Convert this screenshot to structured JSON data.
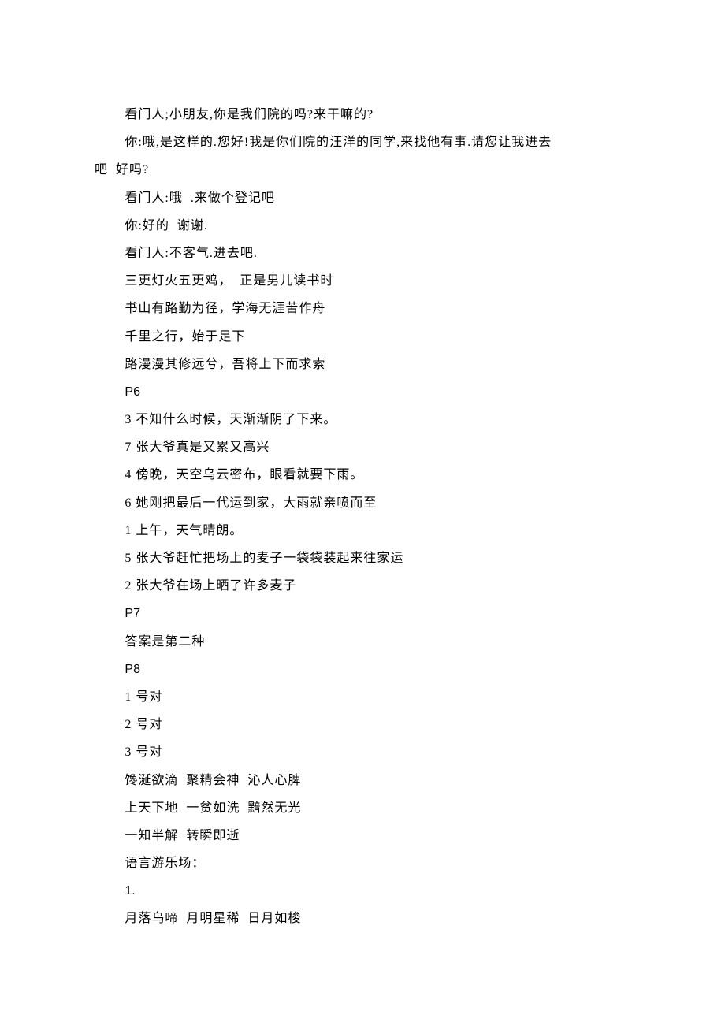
{
  "lines": [
    {
      "text": "看门人;小朋友,你是我们院的吗?来干嘛的?",
      "indent": true
    },
    {
      "text": "你:哦,是这样的.您好!我是你们院的汪洋的同学,来找他有事.请您让我进去",
      "indent": true
    },
    {
      "text": "吧  好吗?",
      "indent": false
    },
    {
      "text": "看门人:哦  .来做个登记吧",
      "indent": true
    },
    {
      "text": "你:好的  谢谢.",
      "indent": true
    },
    {
      "text": "看门人:不客气.进去吧.",
      "indent": true
    },
    {
      "text": "三更灯火五更鸡，  正是男儿读书时",
      "indent": true
    },
    {
      "text": "书山有路勤为径，学海无涯苦作舟",
      "indent": true
    },
    {
      "text": "千里之行，始于足下",
      "indent": true
    },
    {
      "text": "路漫漫其修远兮，吾将上下而求索",
      "indent": true
    },
    {
      "text": "P6",
      "indent": true,
      "alpha": true
    },
    {
      "text": "3 不知什么时候，天渐渐阴了下来。",
      "indent": true
    },
    {
      "text": "7 张大爷真是又累又高兴",
      "indent": true
    },
    {
      "text": "4 傍晚，天空乌云密布，眼看就要下雨。",
      "indent": true
    },
    {
      "text": "6 她刚把最后一代运到家，大雨就亲喷而至",
      "indent": true
    },
    {
      "text": "1 上午，天气晴朗。",
      "indent": true
    },
    {
      "text": "5 张大爷赶忙把场上的麦子一袋袋装起来往家运",
      "indent": true
    },
    {
      "text": "2 张大爷在场上晒了许多麦子",
      "indent": true
    },
    {
      "text": "P7",
      "indent": true,
      "alpha": true
    },
    {
      "text": "答案是第二种",
      "indent": true
    },
    {
      "text": "P8",
      "indent": true,
      "alpha": true
    },
    {
      "text": "1 号对",
      "indent": true
    },
    {
      "text": "2 号对",
      "indent": true
    },
    {
      "text": "3 号对",
      "indent": true
    },
    {
      "text": "馋涎欲滴  聚精会神  沁人心脾",
      "indent": true
    },
    {
      "text": "上天下地  一贫如洗  黯然无光",
      "indent": true
    },
    {
      "text": "一知半解  转瞬即逝",
      "indent": true
    },
    {
      "text": "语言游乐场：",
      "indent": true
    },
    {
      "text": "1.",
      "indent": true,
      "alpha": true
    },
    {
      "text": "月落乌啼  月明星稀  日月如梭",
      "indent": true
    }
  ]
}
